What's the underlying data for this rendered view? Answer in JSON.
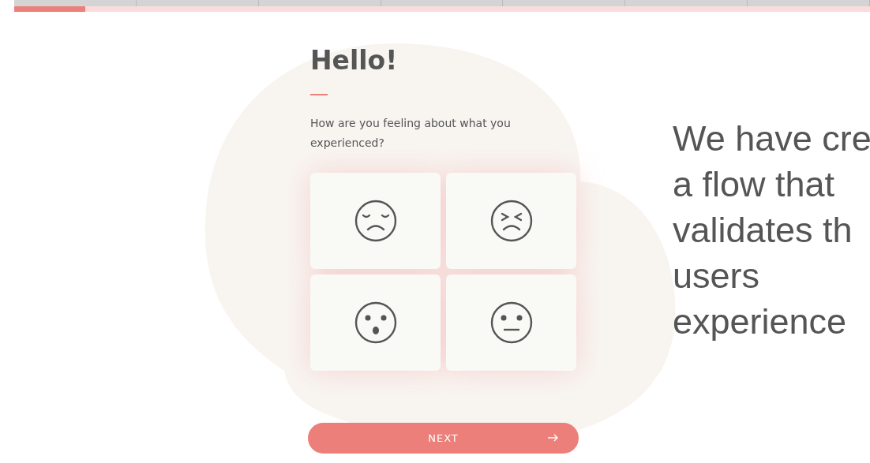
{
  "progress": {
    "level": 0.083
  },
  "title": "Hello!",
  "question": "How are you feeling about what you experienced?",
  "moods": [
    {
      "kind": "sad",
      "selected": false
    },
    {
      "kind": "angry",
      "selected": false
    },
    {
      "kind": "surprised",
      "selected": false
    },
    {
      "kind": "neutral",
      "selected": false
    }
  ],
  "next_button": {
    "label": "NEXT"
  },
  "tagline": [
    "We have cre",
    "a flow that",
    "validates th",
    "users",
    "experience"
  ]
}
